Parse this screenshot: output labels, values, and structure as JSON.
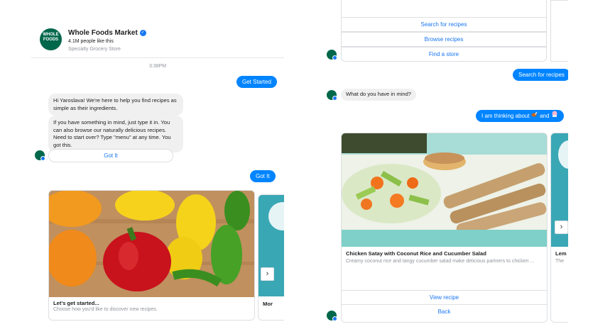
{
  "header": {
    "page_name": "Whole Foods Market",
    "logo_text": "WHOLE FOODS",
    "likes": "4.1M people like this",
    "category": "Specialty Grocery Store"
  },
  "left_chat": {
    "timestamp": "3:38PM",
    "get_started": "Get Started",
    "greeting": "Hi Yaroslava! We're here to help you find recipes as simple as their ingredients.",
    "instructions": "If you have something in mind, just type it in. You can also browse our naturally delicious recipes. Need to start over? Type \"menu\" at any time. You got this.",
    "got_it_button": "Got It",
    "got_it_reply": "Got It",
    "card": {
      "title": "Let's get started...",
      "subtitle": "Choose how you'd like to discover new recipes.",
      "next_peek_title": "Mor"
    }
  },
  "right_chat": {
    "menu": [
      "Search for recipes",
      "Browse recipes",
      "Find a store"
    ],
    "search_reply": "Search for recipes",
    "question": "What do you have in mind?",
    "user_message": "I am thinking about",
    "user_message_joiner": "and",
    "card": {
      "title": "Chicken Satay with Coconut Rice and Cucumber Salad",
      "subtitle": "Creamy coconut rice and tangy cucumber salad make delicious partners to chicken ...",
      "view_button": "View recipe",
      "back_button": "Back",
      "next_peek_title": "Lem",
      "next_peek_sub": "The"
    }
  },
  "icons": {
    "verified": "verified-badge-icon",
    "next": "chevron-right-icon",
    "food1": "drumstick-emoji-icon",
    "food2": "ice-cream-emoji-icon"
  },
  "colors": {
    "messenger_blue": "#0084ff",
    "link_blue": "#1877f2",
    "brand_green": "#00674b",
    "bubble_gray": "#f1f0f0"
  }
}
